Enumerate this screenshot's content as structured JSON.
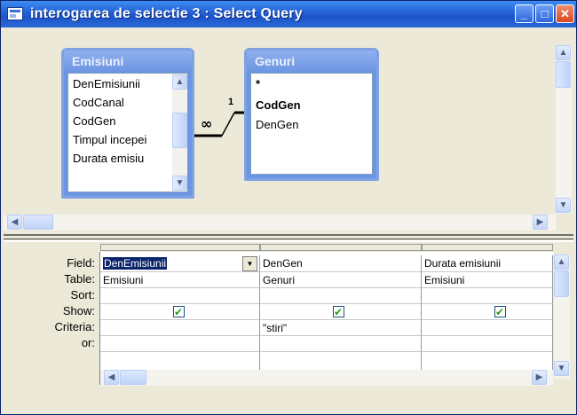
{
  "window": {
    "title": "interogarea de selectie 3 : Select Query",
    "controls": {
      "minimize": "_",
      "maximize": "□",
      "close": "✕"
    }
  },
  "tables": [
    {
      "name": "Emisiuni",
      "fields": [
        "DenEmisiunii",
        "CodCanal",
        "CodGen",
        "Timpul incepei",
        "Durata emisiu"
      ]
    },
    {
      "name": "Genuri",
      "fields": [
        "*",
        "CodGen",
        "DenGen"
      ]
    }
  ],
  "relationship": {
    "one_side": "1",
    "many_side": "∞"
  },
  "grid": {
    "row_labels": [
      "Field:",
      "Table:",
      "Sort:",
      "Show:",
      "Criteria:",
      "or:"
    ],
    "columns": [
      {
        "field": "DenEmisiunii",
        "table": "Emisiuni",
        "sort": "",
        "show": true,
        "criteria": "",
        "or": ""
      },
      {
        "field": "DenGen",
        "table": "Genuri",
        "sort": "",
        "show": true,
        "criteria": "\"stiri\"",
        "or": ""
      },
      {
        "field": "Durata emisiunii",
        "table": "Emisiuni",
        "sort": "",
        "show": true,
        "criteria": "",
        "or": ""
      }
    ]
  },
  "icons": {
    "window": "query-window-icon",
    "scroll_up": "▲",
    "scroll_down": "▼",
    "scroll_left": "◀",
    "scroll_right": "▶",
    "dropdown": "▼"
  },
  "colors": {
    "titlebar": "#2664d8",
    "fieldlist_header": "#6d95e2",
    "selection": "#0a246a",
    "window_bg": "#ece9d8"
  }
}
